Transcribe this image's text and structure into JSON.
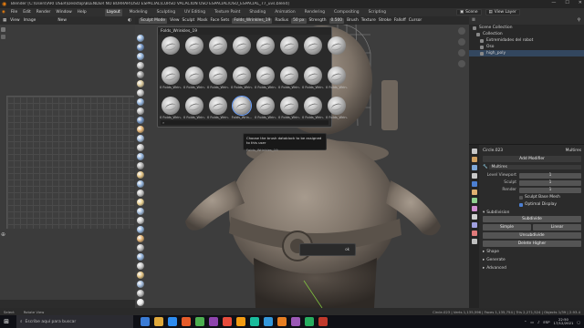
{
  "titlebar": {
    "title": "Blender [C:\\Users\\ARI USER\\Desktop\\BLENDER NO BORRAR\\OSO ESPACIAL\\CURSO VACACION OSO ESPACIAL\\OSO_ESPACIAL_77_uvs.blend]",
    "minimize": "—",
    "maximize": "☐",
    "close": "✕"
  },
  "menubar": {
    "menus": [
      "File",
      "Edit",
      "Render",
      "Window",
      "Help"
    ],
    "workspaces": [
      "Layout",
      "Modeling",
      "Sculpting",
      "UV Editing",
      "Texture Paint",
      "Shading",
      "Animation",
      "Rendering",
      "Compositing",
      "Scripting"
    ],
    "active_workspace": "Layout",
    "scene": "Scene",
    "view_layer": "View Layer"
  },
  "left_panel": {
    "header": [
      "View",
      "Image"
    ],
    "tool_label": "New",
    "bottom_label": "",
    "side_mark": "⊕"
  },
  "viewport": {
    "header_items": [
      "Sculpt Mode",
      "View",
      "Sculpt",
      "Mask",
      "Face Sets"
    ],
    "brush_name": "Folds_Wrinkles_19",
    "radius_label": "Radius",
    "radius_value": "50 px",
    "strength_label": "Strength",
    "strength_value": "0.500",
    "right_items": [
      "Brush",
      "Texture",
      "Stroke",
      "Falloff",
      "Cursor"
    ],
    "mode_label": "Sculpt Mode"
  },
  "brush_popup": {
    "header": "Folds_Wrinkles_19",
    "brushes": [
      "",
      "",
      "",
      "",
      "",
      "",
      "",
      "",
      "0 Folds_Wrin...",
      "0 Folds_Wrin...",
      "0 Folds_Wrin...",
      "0 Folds_Wrin...",
      "0 Folds_Wrin...",
      "0 Folds_Wrin...",
      "0 Folds_Wrin...",
      "0 Folds_Wrin...",
      "0 Folds_Wrin...",
      "0 Folds_Wrin...",
      "0 Folds_Wrin...",
      "Folds_Wrin...",
      "0 Folds_Wrin...",
      "0 Folds_Wrin...",
      "0 Folds_Wrin...",
      "0 Folds_Wrin..."
    ],
    "selected_index": 19,
    "search_icon": "search-icon"
  },
  "tooltip": {
    "line1": "Choose the brush datablock to be assigned to this user",
    "line2": "Folds_Wrinkles_19"
  },
  "opbox": {
    "text": "ok"
  },
  "outliner": {
    "header": "",
    "rows": [
      {
        "label": "Scene Collection",
        "active": false
      },
      {
        "label": "Collection",
        "active": false
      },
      {
        "label": "Extremidades del robot",
        "active": false
      },
      {
        "label": "Oso",
        "active": false
      },
      {
        "label": "high_poly",
        "active": true
      }
    ]
  },
  "properties": {
    "object_name": "Circle.023",
    "modifier_label": "Multires",
    "add_modifier": "Add Modifier",
    "multires_name": "Multires",
    "fields": [
      {
        "k": "Level Viewport",
        "v": "1"
      },
      {
        "k": "Sculpt",
        "v": "1"
      },
      {
        "k": "Render",
        "v": "1"
      }
    ],
    "checks": [
      "Sculpt Base Mesh",
      "Optimal Display"
    ],
    "subdivision_section": "Subdivision",
    "subdivide": "Subdivide",
    "simple": "Simple",
    "linear": "Linear",
    "unsubdivide": "Unsubdivide",
    "delete_higher": "Delete Higher",
    "sections": [
      "Shape",
      "Generate",
      "Advanced"
    ]
  },
  "statusbar": {
    "left": [
      "Select",
      "Rotate View"
    ],
    "right": "Circle.023 | Verts 1,135,596 | Faces 1,135,754 | Tris 2,271,524 | Objects 1/39 | 2.93.4"
  },
  "taskbar": {
    "search_placeholder": "Escribe aquí para buscar",
    "apps": [
      "#3a7bd5",
      "#e0a93b",
      "#2d8cf0",
      "#e65c2a",
      "#4caf50",
      "#8e44ad",
      "#e74c3c",
      "#f39c12",
      "#1abc9c",
      "#3498db",
      "#e67e22",
      "#9b59b6",
      "#27ae60",
      "#c0392b"
    ],
    "lang": "ESP",
    "time": "22:50",
    "date": "17/12/2021"
  },
  "colors": {
    "accent": "#4772b3",
    "viewport_bg": "#3d3d3d"
  }
}
